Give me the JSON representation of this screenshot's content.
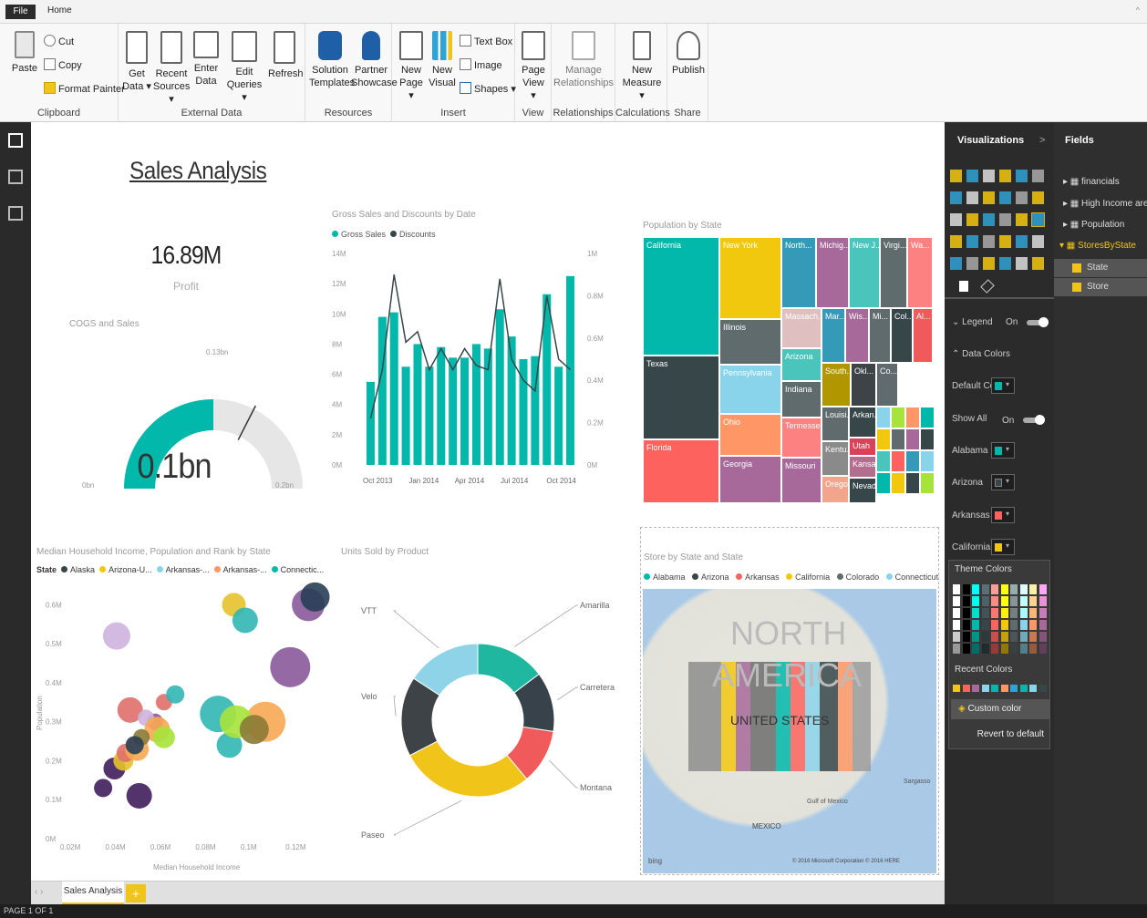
{
  "menu": {
    "file": "File",
    "home": "Home",
    "up_arrow": "^"
  },
  "ribbon": {
    "clipboard": {
      "paste": "Paste",
      "cut": "Cut",
      "copy": "Copy",
      "format_painter": "Format Painter",
      "group": "Clipboard"
    },
    "external": {
      "get_data": [
        "Get",
        "Data ▾"
      ],
      "recent_sources": [
        "Recent",
        "Sources ▾"
      ],
      "enter_data": [
        "Enter",
        "Data"
      ],
      "edit_queries": [
        "Edit",
        "Queries ▾"
      ],
      "refresh": "Refresh",
      "group": "External Data"
    },
    "resources": {
      "solution_templates": [
        "Solution",
        "Templates"
      ],
      "partner_showcase": [
        "Partner",
        "Showcase"
      ],
      "group": "Resources"
    },
    "insert": {
      "new_page": [
        "New",
        "Page ▾"
      ],
      "new_visual": [
        "New",
        "Visual"
      ],
      "text_box": "Text Box",
      "image": "Image",
      "shapes": "Shapes ▾",
      "group": "Insert"
    },
    "view": {
      "page_view": [
        "Page",
        "View ▾"
      ],
      "group": "View"
    },
    "relationships": {
      "manage": [
        "Manage",
        "Relationships"
      ],
      "group": "Relationships"
    },
    "calculations": {
      "new_measure": [
        "New",
        "Measure ▾"
      ],
      "group": "Calculations"
    },
    "share": {
      "publish": "Publish",
      "group": "Share"
    }
  },
  "report": {
    "title": "Sales Analysis",
    "kpi": {
      "value": "16.89M",
      "label": "Profit"
    },
    "gauge": {
      "title": "COGS and Sales",
      "value_text": "0.1bn",
      "target_text": "0.13bn",
      "min": "0bn",
      "max": "0.2bn",
      "value": 0.1,
      "max_value": 0.2,
      "target": 0.13
    },
    "treemap": {
      "title": "Population by State"
    },
    "map": {
      "title": "Store by State and State",
      "legend": [
        "Alabama",
        "Arizona",
        "Arkansas",
        "California",
        "Colorado",
        "Connecticut"
      ],
      "north": "NORTH",
      "america": "AMERICA",
      "us": "UNITED STATES",
      "mexico": "MEXICO",
      "gulf": "Gulf of Mexico",
      "sargasso": "Sargasso",
      "bing": "bing",
      "copyright": "© 2016 Microsoft Corporation  © 2016 HERE"
    }
  },
  "charts": {
    "combo_title": "Gross Sales and Discounts by Date",
    "scatter_title": "Median Household Income, Population and Rank by State",
    "scatter_legend_label": "State",
    "donut_title": "Units Sold by Product"
  },
  "chart_data": [
    {
      "type": "bar",
      "title": "Gross Sales and Discounts by Date",
      "series": [
        {
          "name": "Gross Sales",
          "axis": "left",
          "values": [
            5.5,
            9.8,
            10.1,
            6.5,
            8.0,
            6.5,
            7.8,
            7.1,
            7.1,
            8.0,
            7.7,
            10.3,
            8.5,
            7.0,
            7.2,
            11.3,
            6.5,
            12.5
          ]
        },
        {
          "name": "Discounts",
          "type": "line",
          "axis": "right",
          "values": [
            0.22,
            0.45,
            0.9,
            0.58,
            0.63,
            0.45,
            0.55,
            0.45,
            0.55,
            0.47,
            0.45,
            0.88,
            0.5,
            0.4,
            0.35,
            0.8,
            0.5,
            0.45
          ]
        }
      ],
      "x_ticks": [
        "Oct 2013",
        "Jan 2014",
        "Apr 2014",
        "Jul 2014",
        "Oct 2014"
      ],
      "y_left_ticks": [
        "0M",
        "2M",
        "4M",
        "6M",
        "8M",
        "10M",
        "12M",
        "14M"
      ],
      "y_right_ticks": [
        "0M",
        "0.2M",
        "0.4M",
        "0.6M",
        "0.8M",
        "1M"
      ],
      "ylim": [
        0,
        14
      ],
      "y2lim": [
        0,
        1
      ]
    },
    {
      "type": "scatter",
      "title": "Median Household Income, Population and Rank by State",
      "xlabel": "Median Household Income",
      "ylabel": "Population",
      "x_ticks": [
        "0.02M",
        "0.04M",
        "0.06M",
        "0.08M",
        "0.1M",
        "0.12M"
      ],
      "y_ticks": [
        "0M",
        "0.1M",
        "0.2M",
        "0.3M",
        "0.4M",
        "0.5M",
        "0.6M"
      ],
      "legend": [
        "Alaska",
        "Arizona-U...",
        "Arkansas-...",
        "Arkansas-...",
        "Connectic..."
      ],
      "series": [
        {
          "color": "#3f1d5c",
          "points": [
            [
              0.035,
              0.13,
              10
            ],
            [
              0.04,
              0.18,
              12
            ],
            [
              0.051,
              0.11,
              14
            ]
          ]
        },
        {
          "color": "#e5c22b",
          "points": [
            [
              0.093,
              0.6,
              13
            ],
            [
              0.044,
              0.2,
              11
            ]
          ]
        },
        {
          "color": "#e06f6a",
          "points": [
            [
              0.047,
              0.33,
              14
            ],
            [
              0.045,
              0.22,
              10
            ],
            [
              0.062,
              0.35,
              9
            ]
          ]
        },
        {
          "color": "#31b6b4",
          "points": [
            [
              0.091,
              0.24,
              14
            ],
            [
              0.086,
              0.32,
              20
            ],
            [
              0.098,
              0.56,
              14
            ],
            [
              0.067,
              0.37,
              10
            ]
          ]
        },
        {
          "color": "#8a5a9a",
          "points": [
            [
              0.118,
              0.44,
              22
            ],
            [
              0.126,
              0.6,
              18
            ],
            [
              0.058,
              0.3,
              9
            ]
          ]
        },
        {
          "color": "#cdb3dd",
          "points": [
            [
              0.041,
              0.52,
              15
            ],
            [
              0.054,
              0.31,
              9
            ]
          ]
        },
        {
          "color": "#f7a953",
          "points": [
            [
              0.107,
              0.3,
              22
            ],
            [
              0.05,
              0.23,
              13
            ],
            [
              0.059,
              0.28,
              14
            ]
          ]
        },
        {
          "color": "#a6e33b",
          "points": [
            [
              0.094,
              0.3,
              18
            ],
            [
              0.062,
              0.26,
              12
            ]
          ]
        },
        {
          "color": "#8a7a36",
          "points": [
            [
              0.052,
              0.26,
              9
            ],
            [
              0.102,
              0.28,
              16
            ]
          ]
        },
        {
          "color": "#293f55",
          "points": [
            [
              0.049,
              0.24,
              10
            ],
            [
              0.129,
              0.62,
              16
            ]
          ]
        }
      ]
    },
    {
      "type": "pie",
      "title": "Units Sold by Product",
      "categories": [
        "Amarilla",
        "Carretera",
        "Montana",
        "Paseo",
        "Velo",
        "VTT"
      ],
      "values": [
        14,
        12,
        11,
        27,
        16,
        15
      ],
      "colors": [
        "#1fb7a0",
        "#37424a",
        "#f15a5a",
        "#f0c419",
        "#3d4347",
        "#8fd3e8"
      ]
    },
    {
      "type": "treemap",
      "title": "Population by State",
      "categories": [
        "California",
        "Texas",
        "Florida",
        "New York",
        "Illinois",
        "Pennsylvania",
        "Ohio",
        "Georgia",
        "North...",
        "Massach...",
        "Arizona",
        "Indiana",
        "Tennessee",
        "Missouri",
        "Michig...",
        "New J...",
        "Virgi...",
        "Wa...",
        "Mar...",
        "Wis...",
        "Mi...",
        "Col...",
        "Al...",
        "South...",
        "Okl...",
        "Co...",
        "Louisi...",
        "Kentu...",
        "Oregon",
        "Arkan...",
        "Utah",
        "Kansas",
        "Nevada"
      ]
    }
  ],
  "viz_pane": {
    "title": "Visualizations",
    "chevron": ">",
    "legend": "Legend",
    "legend_state": "On",
    "data_colors": "Data Colors",
    "default_color": "Default Color",
    "show_all": "Show All",
    "show_all_state": "On",
    "alabama": "Alabama",
    "arizona": "Arizona",
    "arkansas": "Arkansas",
    "california": "California",
    "theme_colors": "Theme Colors",
    "recent_colors": "Recent Colors",
    "custom_color": "Custom color",
    "revert": "Revert to default"
  },
  "fields_pane": {
    "title": "Fields",
    "items": [
      "financials",
      "High Income area",
      "Population",
      "StoresByState"
    ],
    "sub": [
      "State",
      "Store"
    ]
  },
  "page_tab": {
    "name": "Sales Analysis",
    "add": "+",
    "nav": "‹  ›"
  },
  "status": "PAGE 1 OF 1",
  "colors": {
    "teal": "#01b8aa",
    "dark": "#374649",
    "red": "#fd625e",
    "yellow": "#f2c80f",
    "gray": "#5f6b6d",
    "lightblue": "#8ad4eb",
    "orange": "#fe9666",
    "purple": "#a66999"
  }
}
